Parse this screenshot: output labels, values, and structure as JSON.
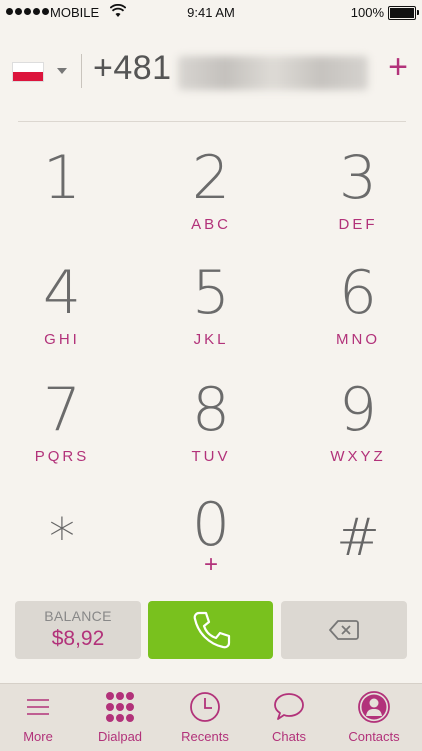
{
  "status_bar": {
    "carrier": "MOBILE",
    "time": "9:41 AM",
    "battery": "100%"
  },
  "entry": {
    "number_prefix": "+481",
    "add_symbol": "+"
  },
  "keypad": {
    "keys": [
      {
        "digit": "1",
        "letters": ""
      },
      {
        "digit": "2",
        "letters": "ABC"
      },
      {
        "digit": "3",
        "letters": "DEF"
      },
      {
        "digit": "4",
        "letters": "GHI"
      },
      {
        "digit": "5",
        "letters": "JKL"
      },
      {
        "digit": "6",
        "letters": "MNO"
      },
      {
        "digit": "7",
        "letters": "PQRS"
      },
      {
        "digit": "8",
        "letters": "TUV"
      },
      {
        "digit": "9",
        "letters": "WXYZ"
      },
      {
        "digit": "*",
        "letters": ""
      },
      {
        "digit": "0",
        "letters": "+"
      },
      {
        "digit": "#",
        "letters": ""
      }
    ]
  },
  "actions": {
    "balance_label": "BALANCE",
    "balance_value": "$8,92"
  },
  "tabs": [
    {
      "label": "More",
      "icon": "menu-icon"
    },
    {
      "label": "Dialpad",
      "icon": "dialpad-icon"
    },
    {
      "label": "Recents",
      "icon": "clock-icon"
    },
    {
      "label": "Chats",
      "icon": "chat-bubble-icon"
    },
    {
      "label": "Contacts",
      "icon": "contact-icon"
    }
  ],
  "colors": {
    "accent": "#b2327a",
    "call": "#79c11e",
    "background": "#f6f3ee"
  }
}
